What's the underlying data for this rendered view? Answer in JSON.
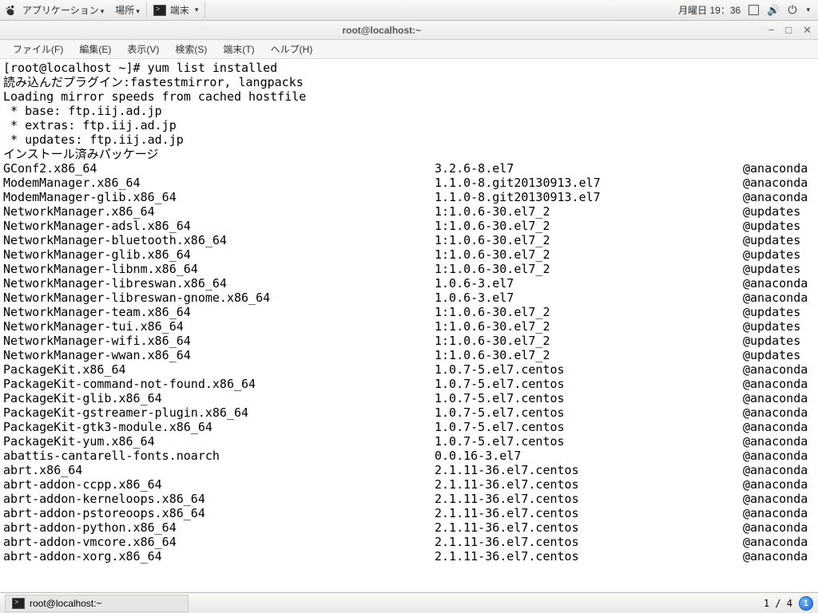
{
  "top_panel": {
    "applications": "アプリケーション",
    "places": "場所",
    "task_label": "端末",
    "date": "月曜日 19：36"
  },
  "window": {
    "title": "root@localhost:~",
    "menubar": [
      "ファイル(F)",
      "編集(E)",
      "表示(V)",
      "検索(S)",
      "端末(T)",
      "ヘルプ(H)"
    ]
  },
  "terminal": {
    "prompt": "[root@localhost ~]# yum list installed",
    "pre_lines": [
      "読み込んだプラグイン:fastestmirror, langpacks",
      "Loading mirror speeds from cached hostfile",
      " * base: ftp.iij.ad.jp",
      " * extras: ftp.iij.ad.jp",
      " * updates: ftp.iij.ad.jp",
      "インストール済みパッケージ"
    ],
    "packages": [
      {
        "name": "GConf2.x86_64",
        "ver": "3.2.6-8.el7",
        "repo": "@anaconda"
      },
      {
        "name": "ModemManager.x86_64",
        "ver": "1.1.0-8.git20130913.el7",
        "repo": "@anaconda"
      },
      {
        "name": "ModemManager-glib.x86_64",
        "ver": "1.1.0-8.git20130913.el7",
        "repo": "@anaconda"
      },
      {
        "name": "NetworkManager.x86_64",
        "ver": "1:1.0.6-30.el7_2",
        "repo": "@updates"
      },
      {
        "name": "NetworkManager-adsl.x86_64",
        "ver": "1:1.0.6-30.el7_2",
        "repo": "@updates"
      },
      {
        "name": "NetworkManager-bluetooth.x86_64",
        "ver": "1:1.0.6-30.el7_2",
        "repo": "@updates"
      },
      {
        "name": "NetworkManager-glib.x86_64",
        "ver": "1:1.0.6-30.el7_2",
        "repo": "@updates"
      },
      {
        "name": "NetworkManager-libnm.x86_64",
        "ver": "1:1.0.6-30.el7_2",
        "repo": "@updates"
      },
      {
        "name": "NetworkManager-libreswan.x86_64",
        "ver": "1.0.6-3.el7",
        "repo": "@anaconda"
      },
      {
        "name": "NetworkManager-libreswan-gnome.x86_64",
        "ver": "1.0.6-3.el7",
        "repo": "@anaconda"
      },
      {
        "name": "NetworkManager-team.x86_64",
        "ver": "1:1.0.6-30.el7_2",
        "repo": "@updates"
      },
      {
        "name": "NetworkManager-tui.x86_64",
        "ver": "1:1.0.6-30.el7_2",
        "repo": "@updates"
      },
      {
        "name": "NetworkManager-wifi.x86_64",
        "ver": "1:1.0.6-30.el7_2",
        "repo": "@updates"
      },
      {
        "name": "NetworkManager-wwan.x86_64",
        "ver": "1:1.0.6-30.el7_2",
        "repo": "@updates"
      },
      {
        "name": "PackageKit.x86_64",
        "ver": "1.0.7-5.el7.centos",
        "repo": "@anaconda"
      },
      {
        "name": "PackageKit-command-not-found.x86_64",
        "ver": "1.0.7-5.el7.centos",
        "repo": "@anaconda"
      },
      {
        "name": "PackageKit-glib.x86_64",
        "ver": "1.0.7-5.el7.centos",
        "repo": "@anaconda"
      },
      {
        "name": "PackageKit-gstreamer-plugin.x86_64",
        "ver": "1.0.7-5.el7.centos",
        "repo": "@anaconda"
      },
      {
        "name": "PackageKit-gtk3-module.x86_64",
        "ver": "1.0.7-5.el7.centos",
        "repo": "@anaconda"
      },
      {
        "name": "PackageKit-yum.x86_64",
        "ver": "1.0.7-5.el7.centos",
        "repo": "@anaconda"
      },
      {
        "name": "abattis-cantarell-fonts.noarch",
        "ver": "0.0.16-3.el7",
        "repo": "@anaconda"
      },
      {
        "name": "abrt.x86_64",
        "ver": "2.1.11-36.el7.centos",
        "repo": "@anaconda"
      },
      {
        "name": "abrt-addon-ccpp.x86_64",
        "ver": "2.1.11-36.el7.centos",
        "repo": "@anaconda"
      },
      {
        "name": "abrt-addon-kerneloops.x86_64",
        "ver": "2.1.11-36.el7.centos",
        "repo": "@anaconda"
      },
      {
        "name": "abrt-addon-pstoreoops.x86_64",
        "ver": "2.1.11-36.el7.centos",
        "repo": "@anaconda"
      },
      {
        "name": "abrt-addon-python.x86_64",
        "ver": "2.1.11-36.el7.centos",
        "repo": "@anaconda"
      },
      {
        "name": "abrt-addon-vmcore.x86_64",
        "ver": "2.1.11-36.el7.centos",
        "repo": "@anaconda"
      },
      {
        "name": "abrt-addon-xorg.x86_64",
        "ver": "2.1.11-36.el7.centos",
        "repo": "@anaconda"
      }
    ]
  },
  "bottom_panel": {
    "task_label": "root@localhost:~",
    "workspace": "1 / 4",
    "badge": "1"
  }
}
